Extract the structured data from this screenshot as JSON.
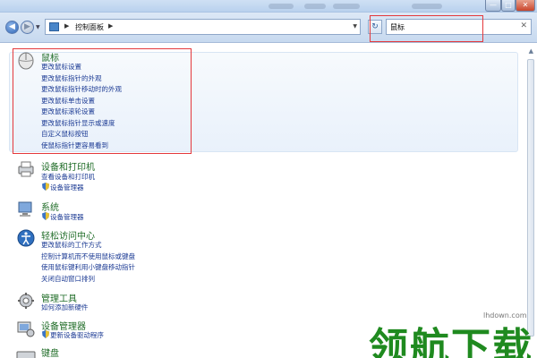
{
  "window": {
    "controls": {
      "minimize": "—",
      "maximize": "□",
      "close": "✕"
    }
  },
  "nav": {
    "back": "◀",
    "forward": "▶",
    "address_segment": "控制面板",
    "search_value": "鼠标",
    "search_clear": "✕",
    "refresh": "↻"
  },
  "results": [
    {
      "title": "鼠标",
      "icon": "mouse-icon",
      "links": [
        "更改鼠标设置",
        "更改鼠标指针的外观",
        "更改鼠标指针移动时的外观",
        "更改鼠标单击设置",
        "更改鼠标滚轮设置",
        "更改鼠标指针显示或速度",
        "自定义鼠标按钮",
        "使鼠标指针更容易看到"
      ]
    },
    {
      "title": "设备和打印机",
      "icon": "printer-icon",
      "links": [
        "查看设备和打印机"
      ],
      "shield_links": [
        "设备管理器"
      ]
    },
    {
      "title": "系统",
      "icon": "computer-icon",
      "links": [],
      "shield_links": [
        "设备管理器"
      ]
    },
    {
      "title": "轻松访问中心",
      "icon": "ease-of-access-icon",
      "links": [
        "更改鼠标的工作方式",
        "控制计算机而不使用鼠标或键盘",
        "使用鼠标键利用小键盘移动指针",
        "关闭自动窗口排列"
      ]
    },
    {
      "title": "管理工具",
      "icon": "admin-tools-icon",
      "links": [
        "如何添加新硬件"
      ]
    },
    {
      "title": "设备管理器",
      "icon": "device-manager-icon",
      "links": [],
      "shield_links": [
        "更新设备驱动程序"
      ]
    },
    {
      "title": "键盘",
      "icon": "keyboard-icon",
      "links": []
    }
  ],
  "watermark": {
    "text": "领航下载",
    "url": "lhdown.com"
  },
  "colors": {
    "title_green": "#1f6c27",
    "link_blue": "#1c3b94",
    "annotation_red": "#e4393c"
  }
}
